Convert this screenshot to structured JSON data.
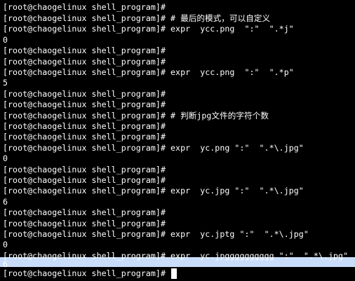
{
  "terminal": {
    "lines": [
      "[root@chaogelinux shell_program]#",
      "[root@chaogelinux shell_program]# # 最后的模式，可以自定义",
      "[root@chaogelinux shell_program]# expr  ycc.png  \":\"  \".*j\"",
      "0",
      "[root@chaogelinux shell_program]#",
      "[root@chaogelinux shell_program]#",
      "[root@chaogelinux shell_program]# expr  ycc.png  \":\"  \".*p\"",
      "5",
      "[root@chaogelinux shell_program]#",
      "[root@chaogelinux shell_program]#",
      "[root@chaogelinux shell_program]# # 判断jpg文件的字符个数",
      "[root@chaogelinux shell_program]#",
      "[root@chaogelinux shell_program]#",
      "[root@chaogelinux shell_program]# expr  yc.png \":\"  \".*\\.jpg\"",
      "0",
      "[root@chaogelinux shell_program]#",
      "[root@chaogelinux shell_program]#",
      "[root@chaogelinux shell_program]# expr  yc.jpg \":\"  \".*\\.jpg\"",
      "6",
      "[root@chaogelinux shell_program]#",
      "[root@chaogelinux shell_program]#",
      "[root@chaogelinux shell_program]# expr  yc.jptg \":\"  \".*\\.jpg\"",
      "0",
      "[root@chaogelinux shell_program]# expr  yc.jpgggggggggg \":\"  \".*\\.jpg\"",
      "6",
      "[root@chaogelinux shell_program]# "
    ]
  },
  "colors": {
    "background": "#000000",
    "text": "#ffffff",
    "selection": "#c9ddfa"
  }
}
